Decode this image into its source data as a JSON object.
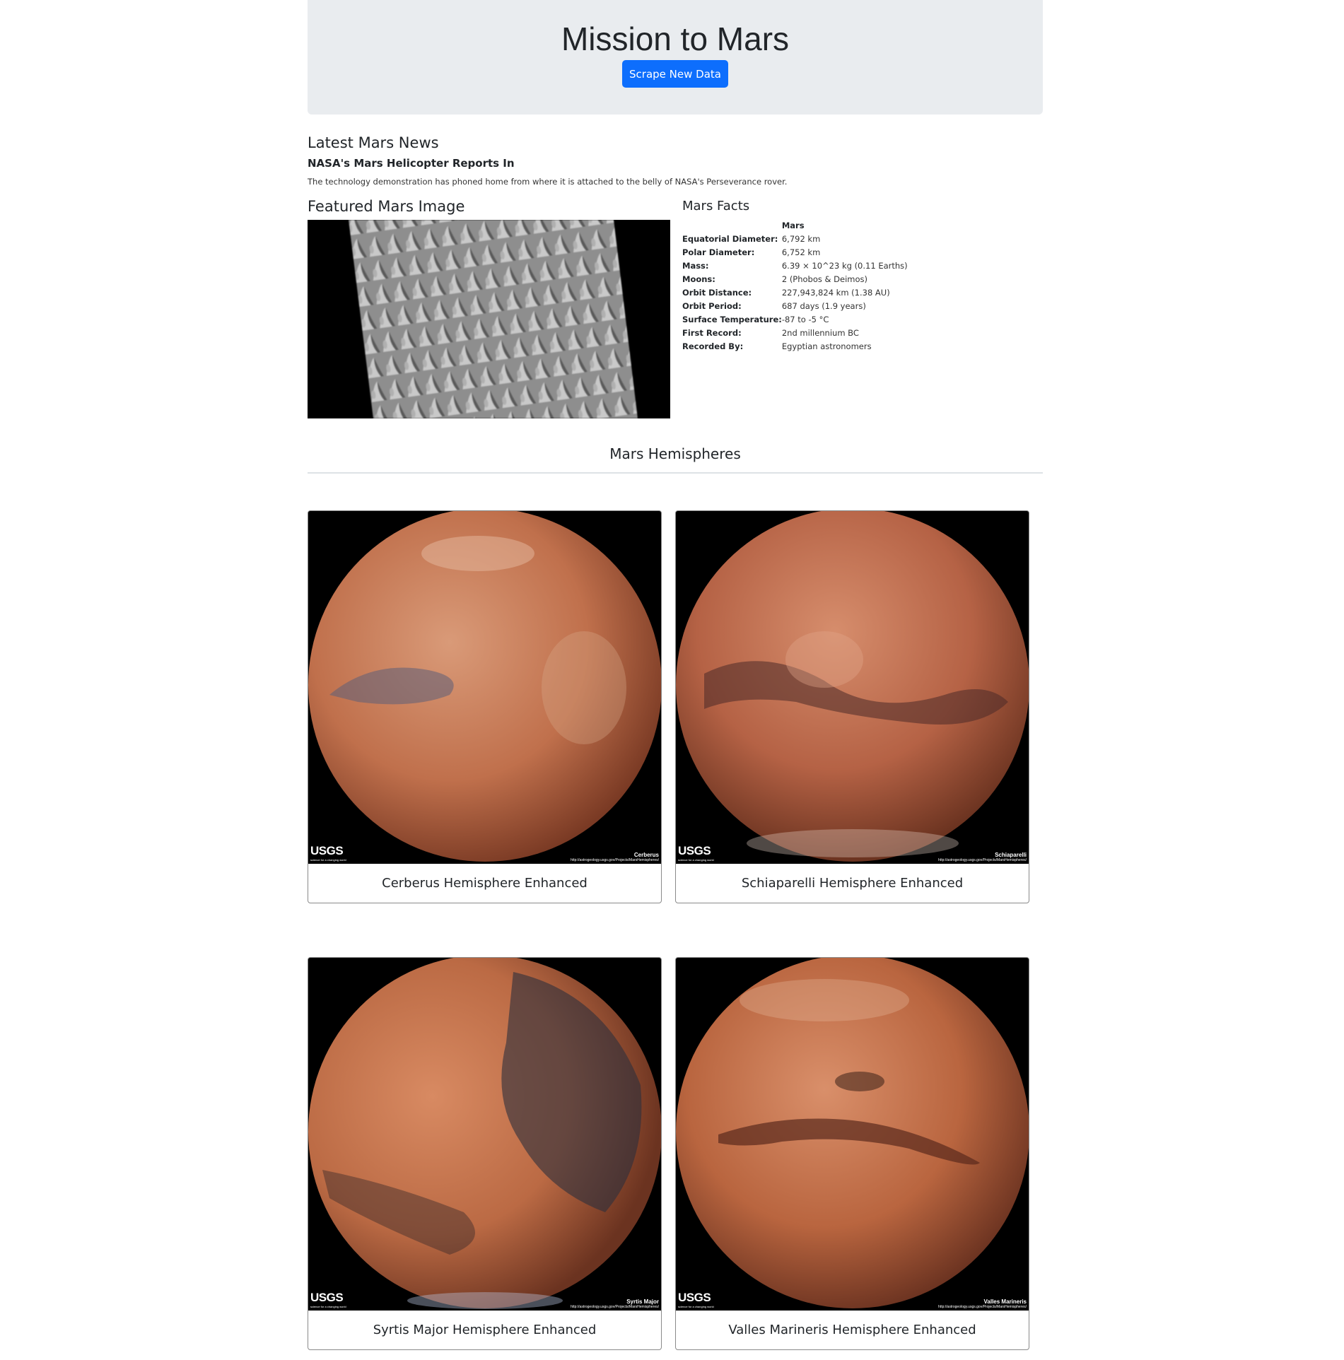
{
  "header": {
    "title": "Mission to Mars",
    "scrape_button": "Scrape New Data"
  },
  "news": {
    "heading": "Latest Mars News",
    "title": "NASA's Mars Helicopter Reports In",
    "paragraph": "The technology demonstration has phoned home from where it is attached to the belly of NASA's Perseverance rover."
  },
  "featured": {
    "heading": "Featured Mars Image"
  },
  "facts": {
    "heading": "Mars Facts",
    "column_header": "Mars",
    "rows": [
      {
        "label": "Equatorial Diameter:",
        "value": "6,792 km"
      },
      {
        "label": "Polar Diameter:",
        "value": "6,752 km"
      },
      {
        "label": "Mass:",
        "value": "6.39 × 10^23 kg (0.11 Earths)"
      },
      {
        "label": "Moons:",
        "value": "2 (Phobos & Deimos)"
      },
      {
        "label": "Orbit Distance:",
        "value": "227,943,824 km (1.38 AU)"
      },
      {
        "label": "Orbit Period:",
        "value": "687 days (1.9 years)"
      },
      {
        "label": "Surface Temperature:",
        "value": "-87 to -5 °C"
      },
      {
        "label": "First Record:",
        "value": "2nd millennium BC"
      },
      {
        "label": "Recorded By:",
        "value": "Egyptian astronomers"
      }
    ]
  },
  "hemispheres": {
    "heading": "Mars Hemispheres",
    "logo_text": "USGS",
    "logo_tagline": "science for a changing world",
    "image_url_caption": "http://astrogeology.usgs.gov/Projects/MarsHemispheres/",
    "items": [
      {
        "title": "Cerberus Hemisphere Enhanced",
        "caption": "Cerberus"
      },
      {
        "title": "Schiaparelli Hemisphere Enhanced",
        "caption": "Schiaparelli"
      },
      {
        "title": "Syrtis Major Hemisphere Enhanced",
        "caption": "Syrtis Major"
      },
      {
        "title": "Valles Marineris Hemisphere Enhanced",
        "caption": "Valles Marineris"
      }
    ]
  },
  "colors": {
    "primary": "#0d6efd",
    "jumbotron": "#e9ecef",
    "mars_light": "#d98a63",
    "mars_dark": "#6b3320"
  }
}
